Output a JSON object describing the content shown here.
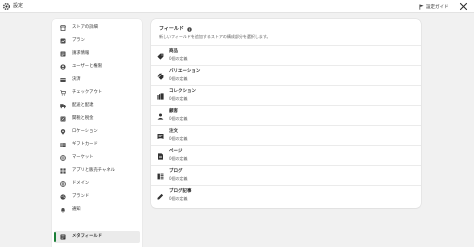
{
  "topbar": {
    "title": "設定",
    "guide_label": "設定ガイド"
  },
  "sidebar": {
    "items": [
      {
        "label": "ストアの詳細",
        "icon": "store-icon",
        "active": false
      },
      {
        "label": "プラン",
        "icon": "plan-icon",
        "active": false
      },
      {
        "label": "請求情報",
        "icon": "billing-icon",
        "active": false
      },
      {
        "label": "ユーザーと権限",
        "icon": "user-icon",
        "active": false
      },
      {
        "label": "決済",
        "icon": "payment-icon",
        "active": false
      },
      {
        "label": "チェックアウト",
        "icon": "cart-icon",
        "active": false
      },
      {
        "label": "配送と配達",
        "icon": "truck-icon",
        "active": false
      },
      {
        "label": "関税と税金",
        "icon": "tax-icon",
        "active": false
      },
      {
        "label": "ロケーション",
        "icon": "location-icon",
        "active": false
      },
      {
        "label": "ギフトカード",
        "icon": "gift-card-icon",
        "active": false
      },
      {
        "label": "マーケット",
        "icon": "globe-icon",
        "active": false
      },
      {
        "label": "アプリと販売チャネル",
        "icon": "apps-icon",
        "active": false
      },
      {
        "label": "ドメイン",
        "icon": "domain-icon",
        "active": false
      },
      {
        "label": "ブランド",
        "icon": "brand-icon",
        "active": false
      },
      {
        "label": "通知",
        "icon": "bell-icon",
        "active": false
      },
      {
        "label": "メタフィールド",
        "icon": "metafield-icon",
        "active": true
      }
    ]
  },
  "main": {
    "title": "フィールド",
    "subtitle": "新しいフィールドを追加するストアの構成部分を選択します。",
    "rows": [
      {
        "name": "商品",
        "count": "0個の定義",
        "icon": "tag-icon"
      },
      {
        "name": "バリエーション",
        "count": "0個の定義",
        "icon": "variant-icon"
      },
      {
        "name": "コレクション",
        "count": "0個の定義",
        "icon": "collection-icon"
      },
      {
        "name": "顧客",
        "count": "0個の定義",
        "icon": "customer-icon"
      },
      {
        "name": "注文",
        "count": "0個の定義",
        "icon": "order-icon"
      },
      {
        "name": "ページ",
        "count": "0個の定義",
        "icon": "page-icon"
      },
      {
        "name": "ブログ",
        "count": "0個の定義",
        "icon": "blog-icon"
      },
      {
        "name": "ブログ記事",
        "count": "0個の定義",
        "icon": "blog-post-icon"
      }
    ]
  },
  "colors": {
    "accent": "#1a7f37",
    "background": "#f1f1f1",
    "surface": "#ffffff",
    "icon": "#4a4a4a"
  }
}
